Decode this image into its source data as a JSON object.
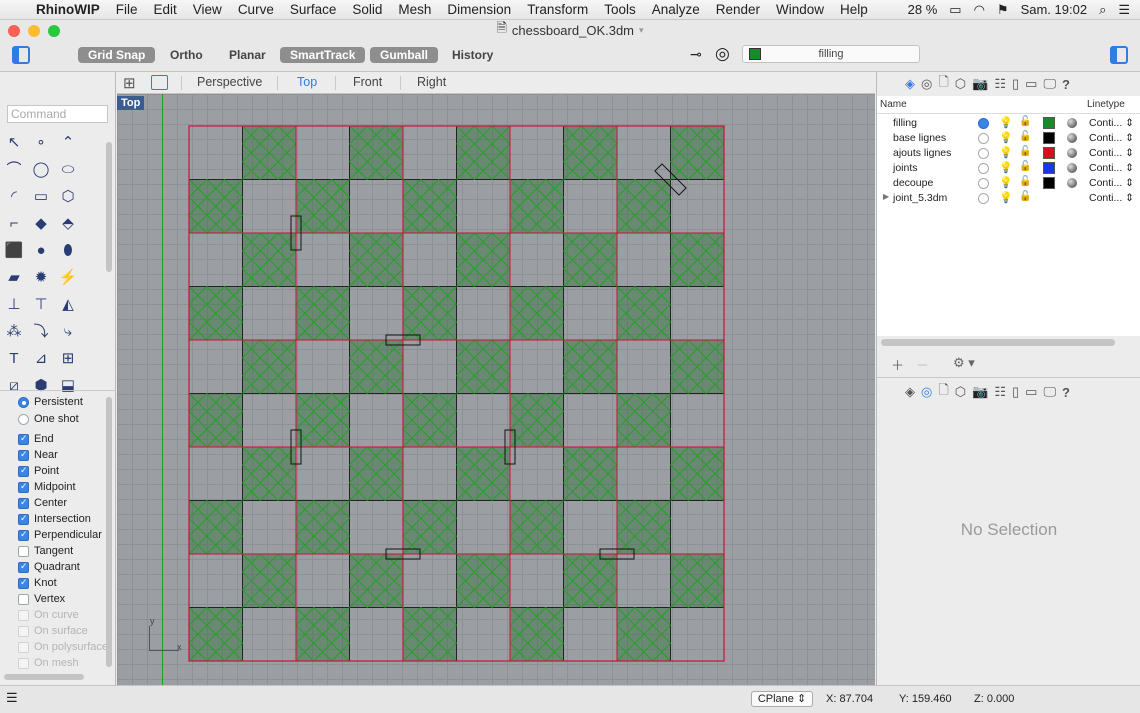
{
  "menubar": {
    "app": "RhinoWIP",
    "items": [
      "File",
      "Edit",
      "View",
      "Curve",
      "Surface",
      "Solid",
      "Mesh",
      "Dimension",
      "Transform",
      "Tools",
      "Analyze",
      "Render",
      "Window",
      "Help"
    ],
    "battery": "28 %",
    "clock": "Sam. 19:02"
  },
  "window": {
    "title": "chessboard_OK.3dm"
  },
  "toolbar": {
    "grid_snap": "Grid Snap",
    "ortho": "Ortho",
    "planar": "Planar",
    "smarttrack": "SmartTrack",
    "gumball": "Gumball",
    "history": "History",
    "current_layer": "filling",
    "current_layer_color": "#188a26"
  },
  "command": {
    "placeholder": "Command"
  },
  "osnap": {
    "persistent": "Persistent",
    "one_shot": "One shot",
    "items": [
      {
        "label": "End",
        "checked": true
      },
      {
        "label": "Near",
        "checked": true
      },
      {
        "label": "Point",
        "checked": true
      },
      {
        "label": "Midpoint",
        "checked": true
      },
      {
        "label": "Center",
        "checked": true
      },
      {
        "label": "Intersection",
        "checked": true
      },
      {
        "label": "Perpendicular",
        "checked": true
      },
      {
        "label": "Tangent",
        "checked": false
      },
      {
        "label": "Quadrant",
        "checked": true
      },
      {
        "label": "Knot",
        "checked": true
      },
      {
        "label": "Vertex",
        "checked": false
      },
      {
        "label": "On curve",
        "checked": false,
        "disabled": true
      },
      {
        "label": "On surface",
        "checked": false,
        "disabled": true
      },
      {
        "label": "On polysurface",
        "checked": false,
        "disabled": true
      },
      {
        "label": "On mesh",
        "checked": false,
        "disabled": true
      }
    ]
  },
  "viewport": {
    "tabs": [
      "Perspective",
      "Top",
      "Front",
      "Right"
    ],
    "active_tab": "Top",
    "label": "Top",
    "axis_y": "y",
    "axis_x": "x",
    "board": {
      "rows": 10,
      "cols": 10,
      "filled_color": "#2f6e3a",
      "hatch_color": "#1fa21f",
      "border_color": "#d0103a"
    }
  },
  "layers": {
    "header_name": "Name",
    "header_linetype": "Linetype",
    "rows": [
      {
        "name": "filling",
        "current": true,
        "color": "#188a26",
        "linetype": "Conti...",
        "expand": false
      },
      {
        "name": "base lignes",
        "current": false,
        "color": "#000000",
        "linetype": "Conti...",
        "expand": false
      },
      {
        "name": "ajouts lignes",
        "current": false,
        "color": "#d8101e",
        "linetype": "Conti...",
        "expand": false
      },
      {
        "name": "joints",
        "current": false,
        "color": "#1838e8",
        "linetype": "Conti...",
        "expand": false
      },
      {
        "name": "decoupe",
        "current": false,
        "color": "#000000",
        "linetype": "Conti...",
        "expand": false
      },
      {
        "name": "joint_5.3dm",
        "current": false,
        "color": null,
        "linetype": "Conti...",
        "expand": true
      }
    ]
  },
  "properties": {
    "empty_text": "No Selection"
  },
  "status": {
    "cplane": "CPlane",
    "x": "X: 87.704",
    "y": "Y: 159.460",
    "z": "Z: 0.000"
  }
}
